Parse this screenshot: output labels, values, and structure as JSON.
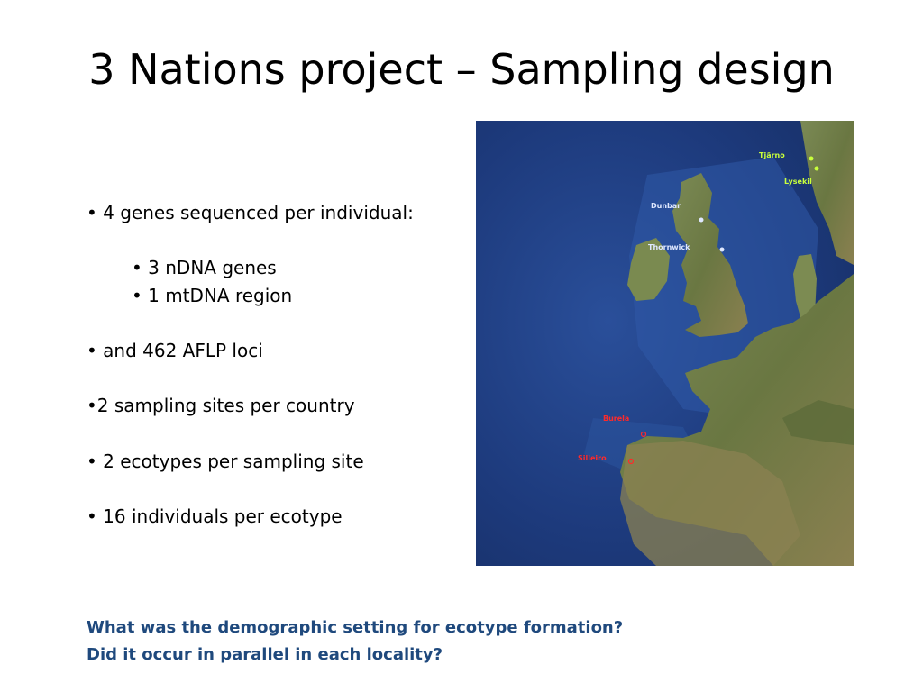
{
  "slide": {
    "title": "3 Nations project – Sampling design",
    "bullets": [
      {
        "text": "• 4 genes sequenced per individual:"
      },
      {
        "text": "• 3 nDNA genes"
      },
      {
        "text": "• 1 mtDNA region"
      },
      {
        "text": "• and 462 AFLP loci"
      },
      {
        "text": "•2 sampling sites per country"
      },
      {
        "text": "• 2 ecotypes per sampling site"
      },
      {
        "text": "• 16 individuals per ecotype"
      }
    ],
    "questions": [
      "What was the demographic setting for ecotype formation?",
      "Did it occur in parallel in each locality?"
    ]
  },
  "map": {
    "sites": [
      {
        "label": "Tjärno",
        "color": "#c8ff3c"
      },
      {
        "label": "Lysekil",
        "color": "#c8ff3c"
      },
      {
        "label": "Dunbar",
        "color": "#dfe8ff"
      },
      {
        "label": "Thornwick",
        "color": "#dfe8ff"
      },
      {
        "label": "Burela",
        "color": "#ff2a2a"
      },
      {
        "label": "Silleiro",
        "color": "#ff2a2a"
      }
    ]
  },
  "colors": {
    "question_text": "#1f497d",
    "ocean": "#1f3f85",
    "land": "#6b7a45"
  }
}
